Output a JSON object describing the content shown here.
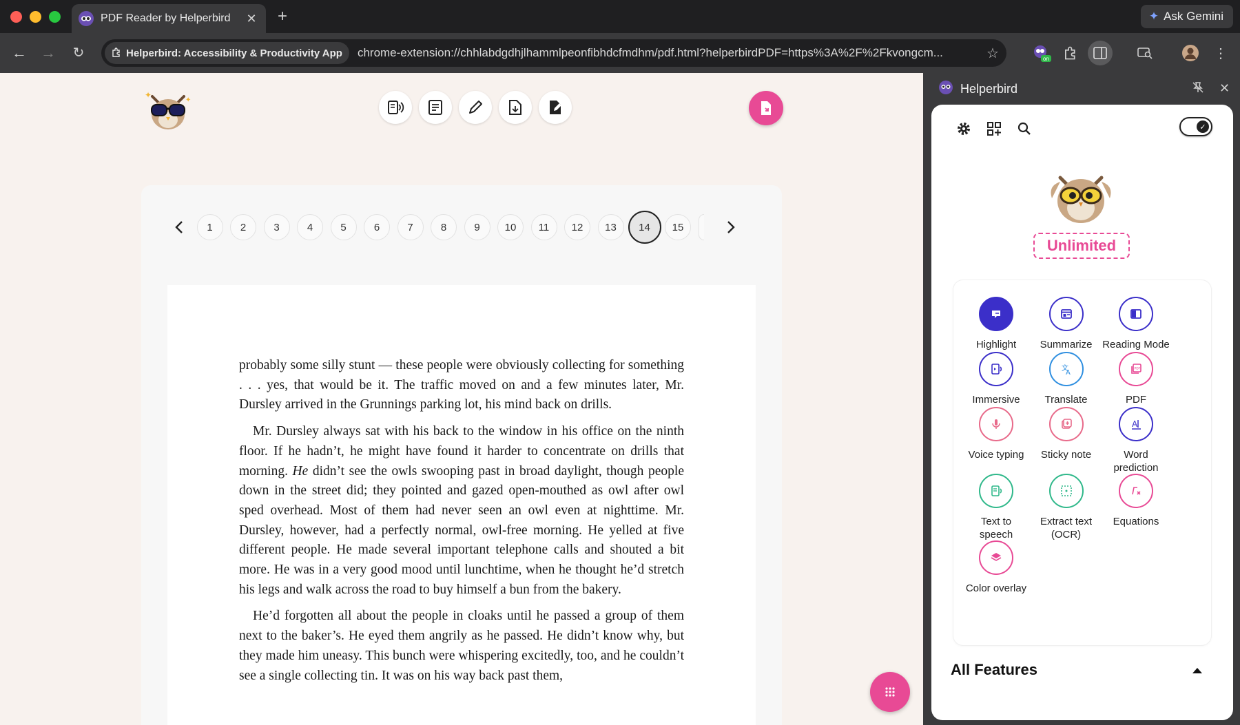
{
  "browser": {
    "tab_title": "PDF Reader by Helperbird",
    "tab_close": "✕",
    "new_tab": "+",
    "ask_gemini": "Ask Gemini",
    "site_chip": "Helperbird: Accessibility & Productivity App",
    "url": "chrome-extension://chhlabdgdhjlhammlpeonfibhdcfmdhm/pdf.html?helperbirdPDF=https%3A%2F%2Fkvongcm...",
    "extension_badge": "on"
  },
  "pager": {
    "pages": [
      "1",
      "2",
      "3",
      "4",
      "5",
      "6",
      "7",
      "8",
      "9",
      "10",
      "11",
      "12",
      "13",
      "14",
      "15"
    ],
    "current": "14",
    "prev": "‹",
    "next": "›"
  },
  "document": {
    "p1": "probably some silly stunt — these people were obviously collecting for something . . . yes, that would be it. The traffic moved on and a few minutes later, Mr. Dursley arrived in the Grunnings parking lot, his mind back on drills.",
    "p2_a": "Mr. Dursley always sat with his back to the window in his office on the ninth floor. If he hadn’t, he might have found it harder to concentrate on drills that morning. ",
    "p2_em": "He",
    "p2_b": " didn’t see the owls swooping past in broad daylight, though people down in the street did; they pointed and gazed open-mouthed as owl after owl sped overhead. Most of them had never seen an owl even at nighttime. Mr. Dursley, however, had a perfectly normal, owl-free morning. He yelled at five different people. He made several important telephone calls and shouted a bit more. He was in a very good mood until lunchtime, when he thought he’d stretch his legs and walk across the road to buy himself a bun from the bakery.",
    "p3": "He’d forgotten all about the people in cloaks until he passed a group of them next to the baker’s. He eyed them angrily as he passed. He didn’t know why, but they made him uneasy. This bunch were whispering excitedly, too, and he couldn’t see a single collecting tin. It was on his way back past them,"
  },
  "sidepanel": {
    "title": "Helperbird",
    "plan_badge": "Unlimited",
    "features": [
      {
        "label": "Highlight",
        "icon": "highlight-icon",
        "color": "#3b2fc9",
        "filled": true
      },
      {
        "label": "Summarize",
        "icon": "summarize-icon",
        "color": "#3b2fc9"
      },
      {
        "label": "Reading Mode",
        "icon": "reading-mode-icon",
        "color": "#3b2fc9"
      },
      {
        "label": "Immersive",
        "icon": "immersive-icon",
        "color": "#3b2fc9"
      },
      {
        "label": "Translate",
        "icon": "translate-icon",
        "color": "#2f8fe0"
      },
      {
        "label": "PDF",
        "icon": "pdf-icon",
        "color": "#e84a95"
      },
      {
        "label": "Voice typing",
        "icon": "microphone-icon",
        "color": "#e86a8a"
      },
      {
        "label": "Sticky note",
        "icon": "sticky-note-icon",
        "color": "#e86a8a"
      },
      {
        "label": "Word prediction",
        "icon": "word-prediction-icon",
        "color": "#3b2fc9"
      },
      {
        "label": "Text to speech",
        "icon": "text-to-speech-icon",
        "color": "#2fb88a"
      },
      {
        "label": "Extract text (OCR)",
        "icon": "ocr-icon",
        "color": "#2fb88a"
      },
      {
        "label": "Equations",
        "icon": "equations-icon",
        "color": "#e84a95"
      },
      {
        "label": "Color overlay",
        "icon": "color-overlay-icon",
        "color": "#e84a95"
      }
    ],
    "all_features": "All Features"
  }
}
